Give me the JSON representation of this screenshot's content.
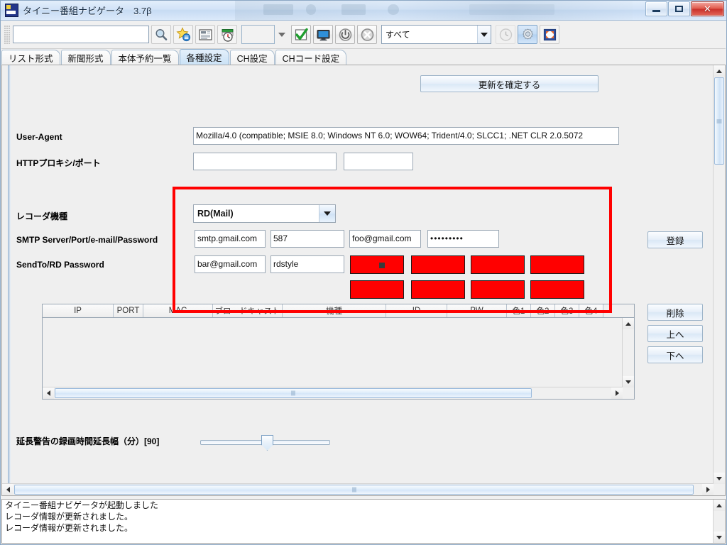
{
  "window": {
    "title": "タイニー番組ナビゲータ　3.7β",
    "icon": "app-icon",
    "buttons": {
      "minimize": "minimize",
      "maximize": "maximize",
      "close": "✕"
    }
  },
  "toolbar": {
    "search_value": "",
    "search_placeholder": "",
    "icons": [
      {
        "name": "search-icon",
        "title": "検索"
      },
      {
        "name": "favorite-star-icon",
        "title": "お気に入り"
      },
      {
        "name": "newspaper-icon",
        "title": "新聞形式"
      },
      {
        "name": "timer-calendar-icon",
        "title": "予約"
      }
    ],
    "small_combo_value": "",
    "check_icon": "green-check-icon",
    "monitor_icon": "monitor-icon",
    "power_icon": "power-icon",
    "cancel_icon": "cancel-icon",
    "filter_value": "すべて",
    "clock_icon": "clock-icon",
    "gear_icon": "gear-icon",
    "fullscreen_icon": "fullscreen-icon"
  },
  "tabs": [
    {
      "label": "リスト形式",
      "active": false
    },
    {
      "label": "新聞形式",
      "active": false
    },
    {
      "label": "本体予約一覧",
      "active": false
    },
    {
      "label": "各種設定",
      "active": true
    },
    {
      "label": "CH設定",
      "active": false
    },
    {
      "label": "CHコード設定",
      "active": false
    }
  ],
  "settings": {
    "commit_button": "更新を確定する",
    "user_agent_label": "User-Agent",
    "user_agent_value": "Mozilla/4.0 (compatible; MSIE 8.0; Windows NT 6.0; WOW64; Trident/4.0; SLCC1; .NET CLR 2.0.5072",
    "proxy_label": "HTTPプロキシ/ポート",
    "proxy_host_value": "",
    "proxy_port_value": "",
    "recorder_model_label": "レコーダ機種",
    "recorder_model_value": "RD(Mail)",
    "smtp_label": "SMTP Server/Port/e-mail/Password",
    "smtp_server_value": "smtp.gmail.com",
    "smtp_port_value": "587",
    "smtp_email_value": "foo@gmail.com",
    "smtp_password_value": "•••••••••",
    "sendto_label": "SendTo/RD Password",
    "sendto_value": "bar@gmail.com",
    "rd_password_value": "rdstyle",
    "redacted_count": 8,
    "register_button": "登録",
    "delete_button": "削除",
    "up_button": "上へ",
    "down_button": "下へ",
    "slider_label": "延長警告の録画時間延長幅（分）[90]",
    "slider_value": 90,
    "slider_min": 0,
    "slider_max": 240
  },
  "table": {
    "columns": [
      {
        "label": "IP",
        "width": 100
      },
      {
        "label": "PORT",
        "width": 42
      },
      {
        "label": "MAC",
        "width": 98
      },
      {
        "label": "ブロードキャスト",
        "width": 98
      },
      {
        "label": "機種",
        "width": 146
      },
      {
        "label": "ID",
        "width": 86
      },
      {
        "label": "PW",
        "width": 84
      },
      {
        "label": "色1",
        "width": 34
      },
      {
        "label": "色2",
        "width": 34
      },
      {
        "label": "色3",
        "width": 34
      },
      {
        "label": "色4",
        "width": 34
      }
    ],
    "rows": []
  },
  "statuslog": {
    "lines": [
      "タイニー番組ナビゲータが起動しました",
      "レコーダ情報が更新されました。",
      "レコーダ情報が更新されました。"
    ]
  },
  "colors": {
    "redaction": "#ff0000",
    "highlight_border": "#ff0000",
    "tab_active": "#cbe2f6",
    "window_bg": "#f0f0f0"
  }
}
